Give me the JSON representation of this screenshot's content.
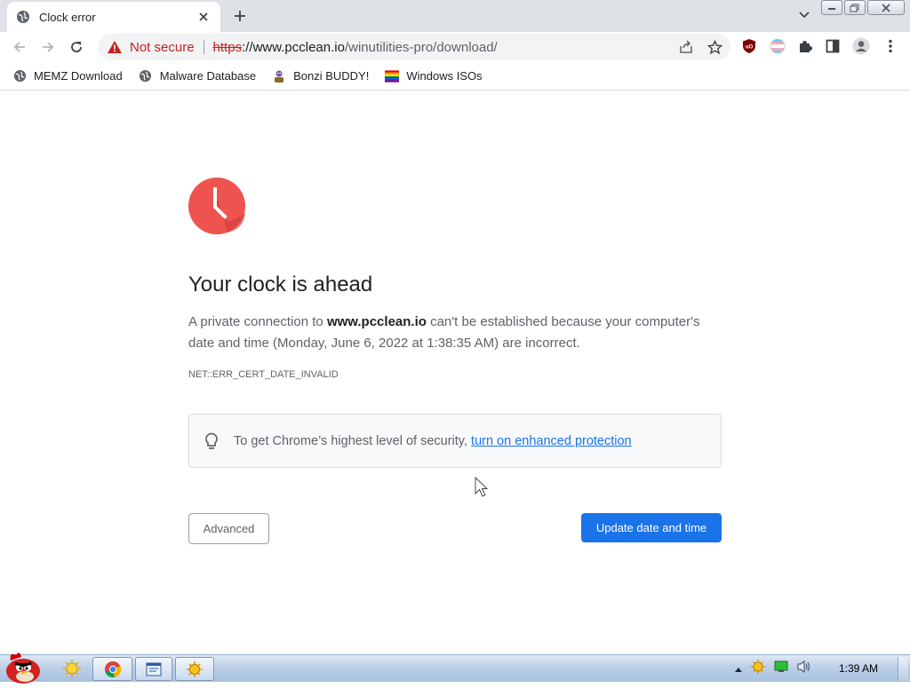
{
  "tab": {
    "title": "Clock error"
  },
  "omnibox": {
    "security_label": "Not secure",
    "url_scheme": "https",
    "url_host": "://www.pcclean.io",
    "url_path": "/winutilities-pro/download/"
  },
  "bookmarks": [
    {
      "label": "MEMZ Download",
      "icon": "globe-icon"
    },
    {
      "label": "Malware Database",
      "icon": "globe-icon"
    },
    {
      "label": "Bonzi BUDDY!",
      "icon": "bonzi-icon"
    },
    {
      "label": "Windows ISOs",
      "icon": "rainbow-flag-icon"
    }
  ],
  "error": {
    "heading": "Your clock is ahead",
    "para_prefix": "A private connection to ",
    "para_host": "www.pcclean.io",
    "para_suffix": " can't be established because your computer's date and time (Monday, June 6, 2022 at 1:38:35 AM) are incorrect.",
    "code": "NET::ERR_CERT_DATE_INVALID",
    "info_text": "To get Chrome’s highest level of security, ",
    "info_link": "turn on enhanced protection",
    "advanced_label": "Advanced",
    "update_label": "Update date and time"
  },
  "taskbar": {
    "time": "1:39 AM"
  },
  "colors": {
    "accent": "#1a73e8",
    "danger": "#c5221f",
    "clock_red": "#ef5350"
  }
}
